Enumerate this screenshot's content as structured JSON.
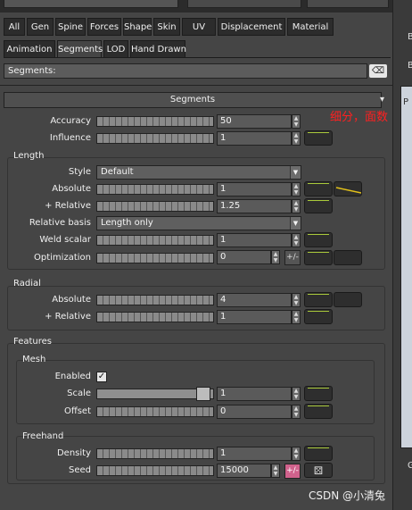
{
  "tabs": {
    "row1": [
      "All",
      "Gen",
      "Spine",
      "Forces",
      "Shape",
      "Skin",
      "UV",
      "Displacement",
      "Material"
    ],
    "row2": [
      "Animation",
      "Segments",
      "LOD",
      "Hand Drawn"
    ],
    "active": "Segments"
  },
  "label_bar": {
    "text": "Segments:",
    "clear_icon": "⌫"
  },
  "section": {
    "title": "Segments",
    "collapse_icon": "▾"
  },
  "annotation": "细分，面数",
  "top_params": {
    "accuracy": {
      "label": "Accuracy",
      "value": "50"
    },
    "influence": {
      "label": "Influence",
      "value": "1"
    }
  },
  "length": {
    "title": "Length",
    "style": {
      "label": "Style",
      "value": "Default"
    },
    "absolute": {
      "label": "Absolute",
      "value": "1"
    },
    "relative": {
      "label": "+ Relative",
      "value": "1.25"
    },
    "relative_basis": {
      "label": "Relative basis",
      "value": "Length only"
    },
    "weld_scalar": {
      "label": "Weld scalar",
      "value": "1"
    },
    "optimization": {
      "label": "Optimization",
      "value": "0",
      "pm": "+/-"
    }
  },
  "radial": {
    "title": "Radial",
    "absolute": {
      "label": "Absolute",
      "value": "4"
    },
    "relative": {
      "label": "+ Relative",
      "value": "1"
    }
  },
  "features": {
    "title": "Features",
    "mesh": {
      "title": "Mesh",
      "enabled": {
        "label": "Enabled",
        "checked": true,
        "check_glyph": "✓"
      },
      "scale": {
        "label": "Scale",
        "value": "1",
        "fill": 0.95
      },
      "offset": {
        "label": "Offset",
        "value": "0"
      }
    },
    "freehand": {
      "title": "Freehand",
      "density": {
        "label": "Density",
        "value": "1"
      },
      "seed": {
        "label": "Seed",
        "value": "15000",
        "pm": "+/-",
        "dice_icon": "⚄"
      }
    }
  },
  "right_panel": {
    "letter_b1": "B",
    "letter_b2": "B",
    "letter_pe": "pe",
    "letter_p": "P",
    "letter_g": "G"
  },
  "watermark": "CSDN @小清兔",
  "colors": {
    "key_accent": "#a9c93a",
    "annotation": "#ff2020",
    "pm_pink": "#d0628c"
  }
}
